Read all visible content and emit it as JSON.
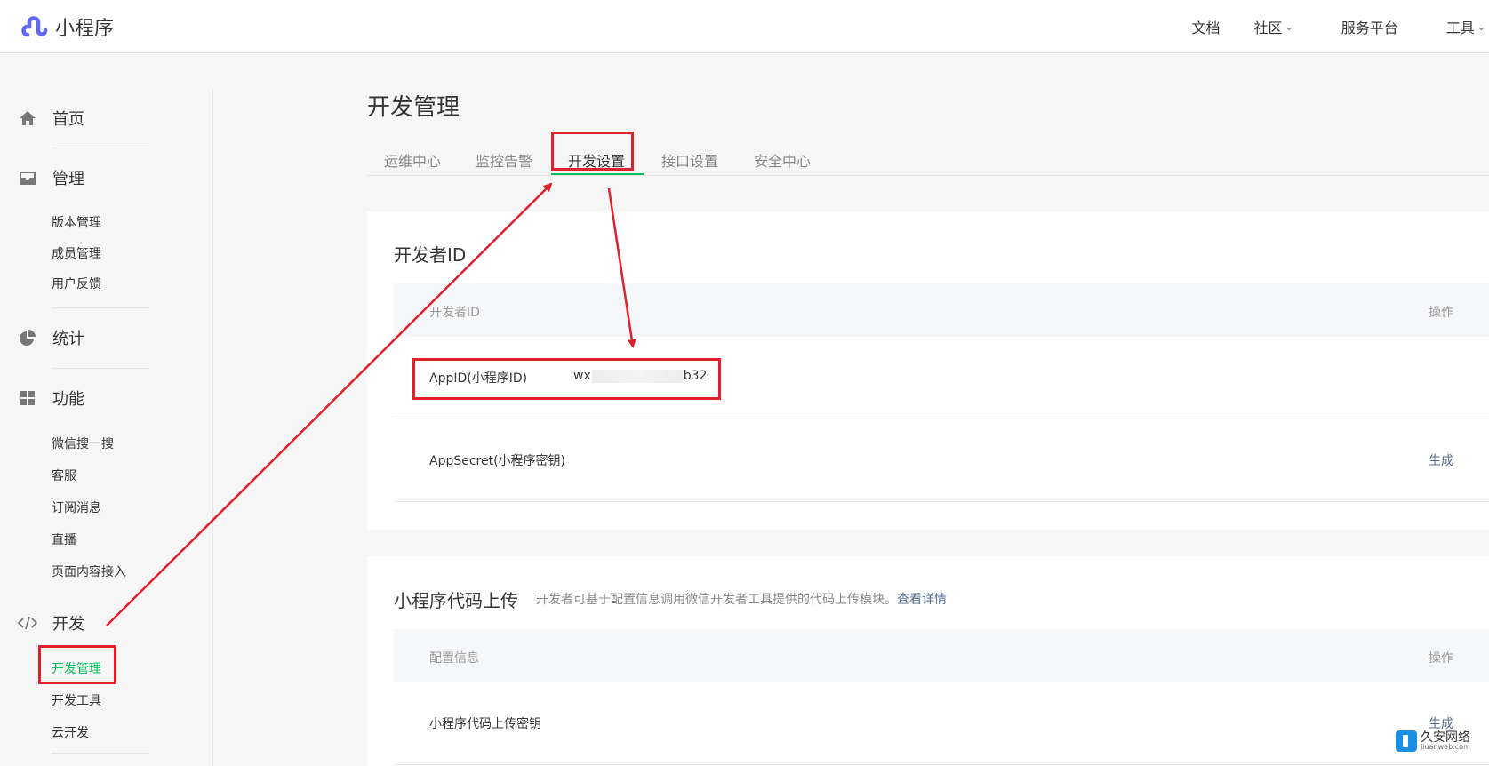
{
  "app": {
    "title": "小程序"
  },
  "topnav": {
    "docs": "文档",
    "community": "社区",
    "service_platform": "服务平台",
    "tools": "工具"
  },
  "sidebar": {
    "home": "首页",
    "manage": {
      "label": "管理",
      "items": [
        "版本管理",
        "成员管理",
        "用户反馈"
      ]
    },
    "stats": "统计",
    "features": {
      "label": "功能",
      "items": [
        "微信搜一搜",
        "客服",
        "订阅消息",
        "直播",
        "页面内容接入"
      ]
    },
    "dev": {
      "label": "开发",
      "items": [
        "开发管理",
        "开发工具",
        "云开发"
      ]
    }
  },
  "main": {
    "title": "开发管理",
    "tabs": [
      "运维中心",
      "监控告警",
      "开发设置",
      "接口设置",
      "安全中心"
    ],
    "active_tab": "开发设置"
  },
  "dev_id_card": {
    "title": "开发者ID",
    "header": {
      "col1": "开发者ID",
      "col2": "操作"
    },
    "appid": {
      "label": "AppID(小程序ID)",
      "prefix": "wx",
      "suffix": "b32"
    },
    "appsecret": {
      "label": "AppSecret(小程序密钥)",
      "action": "生成"
    }
  },
  "upload_card": {
    "title": "小程序代码上传",
    "desc": "开发者可基于配置信息调用微信开发者工具提供的代码上传模块。",
    "desc_link": "查看详情",
    "header": {
      "col1": "配置信息",
      "col2": "操作"
    },
    "row": {
      "label": "小程序代码上传密钥",
      "action": "生成"
    }
  },
  "watermark": {
    "name": "久安网络",
    "domain": "Jiuanweb.com"
  },
  "colors": {
    "accent_green": "#07c160",
    "link_blue": "#576b95",
    "highlight_red": "#e0202a",
    "logo_purple": "#6467f0"
  }
}
